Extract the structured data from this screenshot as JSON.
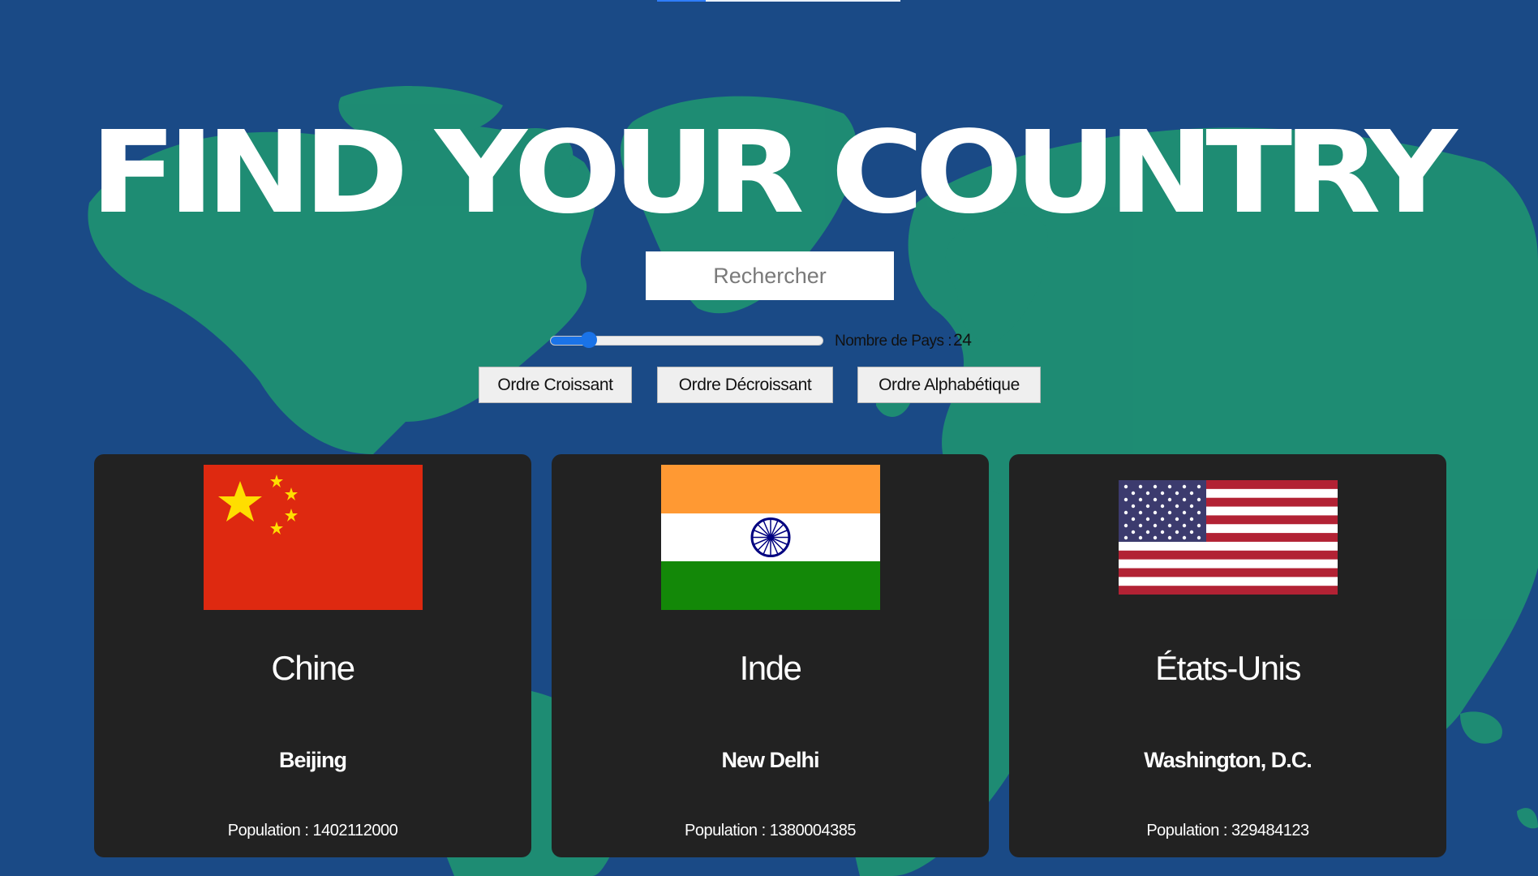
{
  "header": {
    "title": "FIND YOUR COUNTRY"
  },
  "search": {
    "placeholder": "Rechercher",
    "value": ""
  },
  "range": {
    "label": "Nombre de Pays :",
    "value": "24",
    "fraction": 0.14
  },
  "sort_buttons": {
    "ascending": "Ordre Croissant",
    "descending": "Ordre Décroissant",
    "alphabetical": "Ordre Alphabétique"
  },
  "countries": [
    {
      "name": "Chine",
      "capital": "Beijing",
      "population": "Population : 1402112000",
      "flag_icon": "china-flag-icon"
    },
    {
      "name": "Inde",
      "capital": "New Delhi",
      "population": "Population : 1380004385",
      "flag_icon": "india-flag-icon"
    },
    {
      "name": "États-Unis",
      "capital": "Washington, D.C.",
      "population": "Population : 329484123",
      "flag_icon": "usa-flag-icon"
    }
  ],
  "colors": {
    "ocean": "#1a4a86",
    "land": "#1f8f72",
    "card": "#222222",
    "accent": "#1a73e8"
  }
}
